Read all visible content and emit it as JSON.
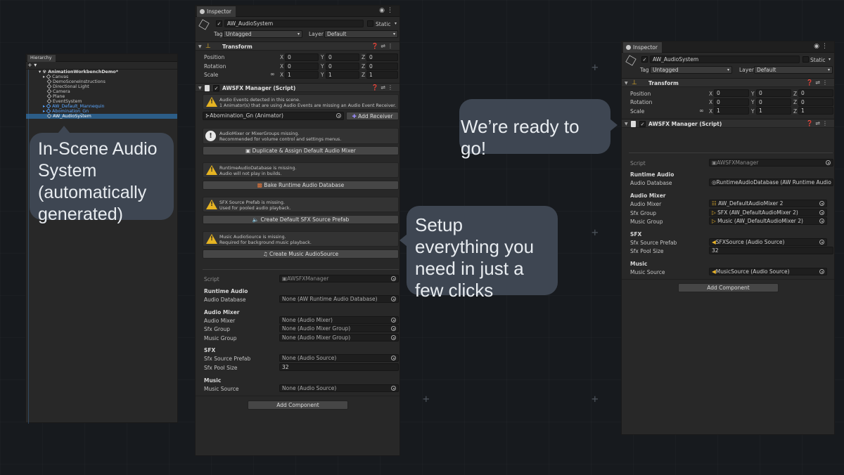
{
  "hierarchy": {
    "tab_label": "Hierarchy",
    "add_label": "+ ▾",
    "root": "AnimationWorkbenchDemo*",
    "items": [
      "Canvas",
      "DemoSceneInstructions",
      "Directional Light",
      "Camera",
      "Plane",
      "EventSystem",
      "AW_Default_Mannequin",
      "Abomination_Gn",
      "AW_AudioSystem"
    ]
  },
  "callouts": {
    "left": "In-Scene Audio System (automatically generated)",
    "middle": "Setup everything you need in just a few clicks",
    "right": "We’re ready to go!"
  },
  "inspector": {
    "tab_label": "Inspector",
    "object_name": "AW_AudioSystem",
    "static_label": "Static",
    "tag_label": "Tag",
    "tag_value": "Untagged",
    "layer_label": "Layer",
    "layer_value": "Default",
    "transform": {
      "title": "Transform",
      "rows": [
        {
          "label": "Position",
          "x": "0",
          "y": "0",
          "z": "0"
        },
        {
          "label": "Rotation",
          "x": "0",
          "y": "0",
          "z": "0"
        },
        {
          "label": "Scale",
          "x": "1",
          "y": "1",
          "z": "1"
        }
      ],
      "axis_x": "X",
      "axis_y": "Y",
      "axis_z": "Z"
    },
    "manager_title": "AWSFX Manager (Script)",
    "help1_line1": "Audio Events detected in this scene.",
    "help1_line2": "1 Animator(s) that are using Audio Events are missing an Audio Event Receiver.",
    "animator_field": "⊱Abomination_Gn (Animator)",
    "add_receiver": "Add Receiver",
    "help2_line1": "AudioMixer or MixerGroups missing.",
    "help2_line2": "Recommended for volume control and settings menus.",
    "btn_mixer": "Duplicate & Assign Default Audio Mixer",
    "help3_line1": "RuntimeAudioDatabase is missing.",
    "help3_line2": "Audio will not play in builds.",
    "btn_database": "Bake Runtime Audio Database",
    "help4_line1": "SFX Source Prefab is missing.",
    "help4_line2": "Used for pooled audio playback.",
    "btn_sfx": "Create Default SFX Source Prefab",
    "help5_line1": "Music AudioSource is missing.",
    "help5_line2": "Required for background music playback.",
    "btn_music": "Create Music AudioSource",
    "script_label": "Script",
    "script_value": "AWSFXManager",
    "runtime_audio": "Runtime Audio",
    "audio_database_label": "Audio Database",
    "audio_database_value": "None (AW Runtime Audio Database)",
    "audio_mixer_head": "Audio Mixer",
    "audio_mixer_label": "Audio Mixer",
    "audio_mixer_value": "None (Audio Mixer)",
    "sfx_group_label": "Sfx Group",
    "sfx_group_value": "None (Audio Mixer Group)",
    "music_group_label": "Music Group",
    "music_group_value": "None (Audio Mixer Group)",
    "sfx_head": "SFX",
    "sfx_prefab_label": "Sfx Source Prefab",
    "sfx_prefab_value": "None (Audio Source)",
    "sfx_pool_label": "Sfx Pool Size",
    "sfx_pool_value": "32",
    "music_head": "Music",
    "music_source_label": "Music Source",
    "music_source_value": "None (Audio Source)",
    "add_component": "Add Component"
  },
  "inspector2": {
    "tab_label": "Inspector",
    "object_name": "AW_AudioSystem",
    "static_label": "Static",
    "tag_label": "Tag",
    "tag_value": "Untagged",
    "layer_label": "Layer",
    "layer_value": "Default",
    "transform_title": "Transform",
    "rows": [
      {
        "label": "Position",
        "x": "0",
        "y": "0",
        "z": "0"
      },
      {
        "label": "Rotation",
        "x": "0",
        "y": "0",
        "z": "0"
      },
      {
        "label": "Scale",
        "x": "1",
        "y": "1",
        "z": "1"
      }
    ],
    "manager_title": "AWSFX Manager (Script)",
    "script_label": "Script",
    "script_value": "AWSFXManager",
    "runtime_audio": "Runtime Audio",
    "audio_database_label": "Audio Database",
    "audio_database_value": "RuntimeAudioDatabase (AW Runtime Audio",
    "audio_mixer_head": "Audio Mixer",
    "audio_mixer_label": "Audio Mixer",
    "audio_mixer_value": "AW_DefaultAudioMixer 2",
    "sfx_group_label": "Sfx Group",
    "sfx_group_value": "SFX (AW_DefaultAudioMixer 2)",
    "music_group_label": "Music Group",
    "music_group_value": "Music (AW_DefaultAudioMixer 2)",
    "sfx_head": "SFX",
    "sfx_prefab_label": "Sfx Source Prefab",
    "sfx_prefab_value": "SFXSource (Audio Source)",
    "sfx_pool_label": "Sfx Pool Size",
    "sfx_pool_value": "32",
    "music_head": "Music",
    "music_source_label": "Music Source",
    "music_source_value": "MusicSource (Audio Source)",
    "add_component": "Add Component"
  },
  "colors": {
    "background": "#171a1e",
    "panel": "#282828",
    "callout": "#3e4652",
    "warning": "#e6b422",
    "selection": "#2c5d87"
  }
}
